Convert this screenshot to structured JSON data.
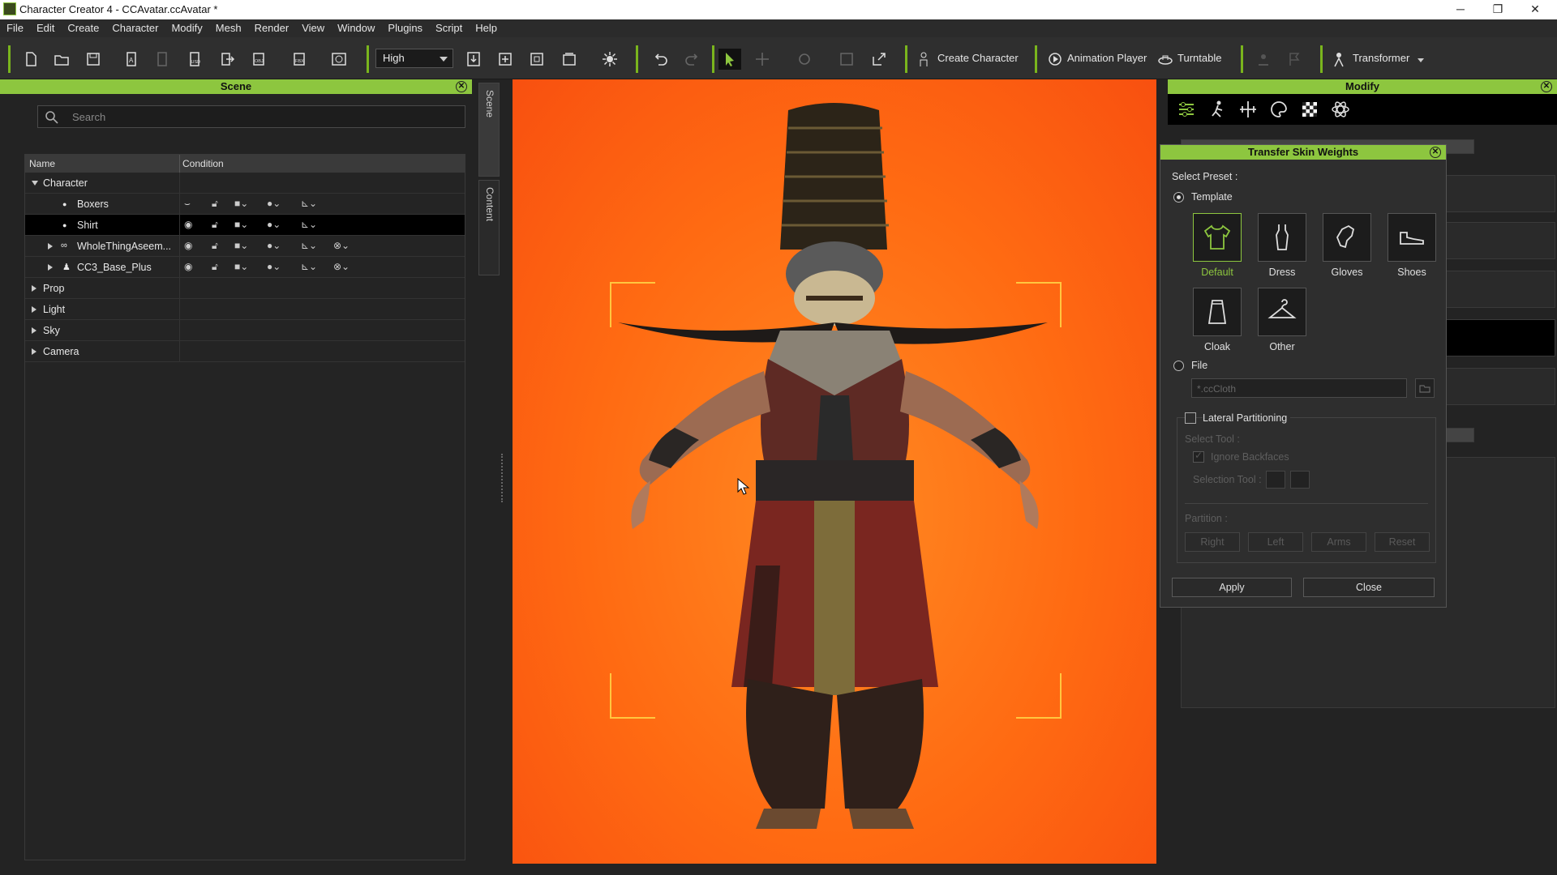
{
  "window": {
    "title": "Character Creator 4 - CCAvatar.ccAvatar *",
    "minimize": "─",
    "restore": "❐",
    "close": "✕"
  },
  "menu": [
    "File",
    "Edit",
    "Create",
    "Character",
    "Modify",
    "Mesh",
    "Render",
    "View",
    "Window",
    "Plugins",
    "Script",
    "Help"
  ],
  "toolbar": {
    "quality": "High",
    "create_character": "Create Character",
    "animation_player": "Animation Player",
    "turntable": "Turntable",
    "transformer": "Transformer"
  },
  "scene": {
    "title": "Scene",
    "search_placeholder": "Search",
    "col_name": "Name",
    "col_condition": "Condition",
    "rows": [
      {
        "label": "Character"
      },
      {
        "label": "Boxers"
      },
      {
        "label": "Shirt"
      },
      {
        "label": "WholeThingAseem..."
      },
      {
        "label": "CC3_Base_Plus"
      },
      {
        "label": "Prop"
      },
      {
        "label": "Light"
      },
      {
        "label": "Sky"
      },
      {
        "label": "Camera"
      }
    ]
  },
  "sidetabs": {
    "scene": "Scene",
    "content": "Content"
  },
  "modify": {
    "title": "Modify"
  },
  "dialog": {
    "title": "Transfer Skin Weights",
    "select_preset": "Select Preset :",
    "template": "Template",
    "templates": [
      {
        "label": "Default",
        "icon": "shirt-icon"
      },
      {
        "label": "Dress",
        "icon": "dress-icon"
      },
      {
        "label": "Gloves",
        "icon": "glove-icon"
      },
      {
        "label": "Shoes",
        "icon": "shoe-icon"
      },
      {
        "label": "Cloak",
        "icon": "cloak-icon"
      },
      {
        "label": "Other",
        "icon": "hanger-icon"
      }
    ],
    "file": "File",
    "file_placeholder": "*.ccCloth",
    "lateral": "Lateral Partitioning",
    "select_tool": "Select Tool :",
    "ignore_backfaces": "Ignore Backfaces",
    "selection_tool": "Selection Tool :",
    "partition": "Partition :",
    "right": "Right",
    "left": "Left",
    "arms": "Arms",
    "reset": "Reset",
    "apply": "Apply",
    "close": "Close"
  },
  "colors": {
    "accent": "#8dc63f",
    "viewport": "#ff6a12",
    "frame": "#ffc640"
  }
}
